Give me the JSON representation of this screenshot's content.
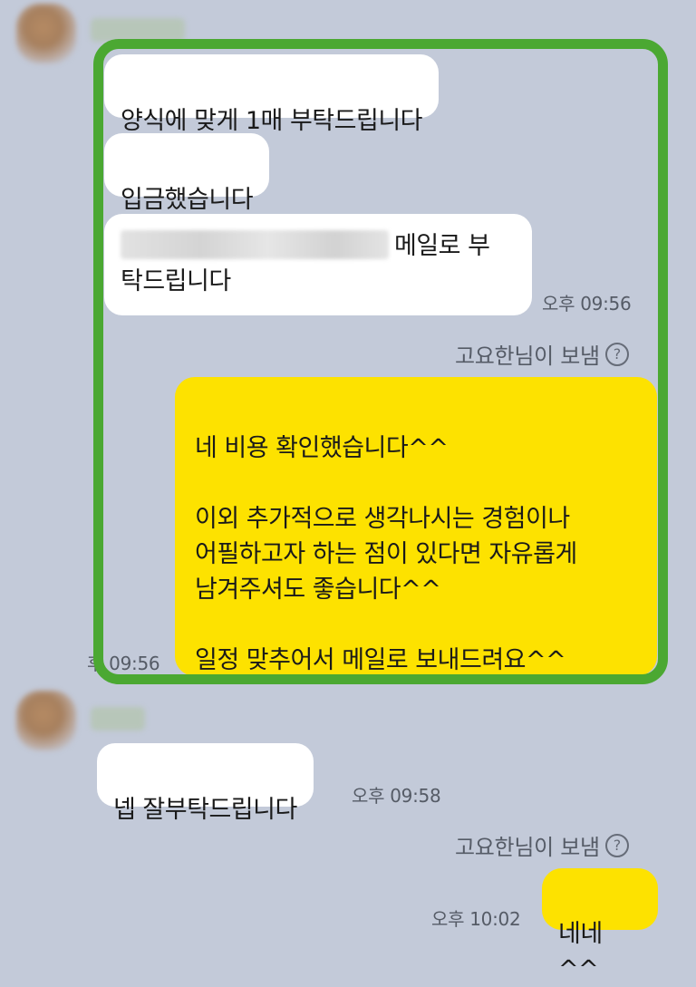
{
  "messages": {
    "m1": "양식에 맞게 1매 부탁드립니다",
    "m2": "입금했습니다",
    "m3_suffix": "메일로 부",
    "m3_line2": "탁드립니다",
    "m3_time": "오후 09:56",
    "sent_by_1": "고요한님이 보냄",
    "reply_1": "네 비용 확인했습니다^^\n\n이외 추가적으로 생각나시는 경험이나\n어필하고자 하는 점이 있다면 자유롭게\n남겨주셔도 좋습니다^^\n\n일정 맞추어서 메일로 보내드려요^^",
    "reply_1_time": "후 09:56",
    "m4": "넵 잘부탁드립니다",
    "m4_time": "오후 09:58",
    "sent_by_2": "고요한님이 보냄",
    "reply_2": "네네^^",
    "reply_2_time": "오후 10:02",
    "help_glyph": "?"
  },
  "colors": {
    "background": "#c3cad9",
    "incoming_bubble": "#ffffff",
    "outgoing_bubble": "#fde200",
    "highlight_border": "#4ba832"
  }
}
